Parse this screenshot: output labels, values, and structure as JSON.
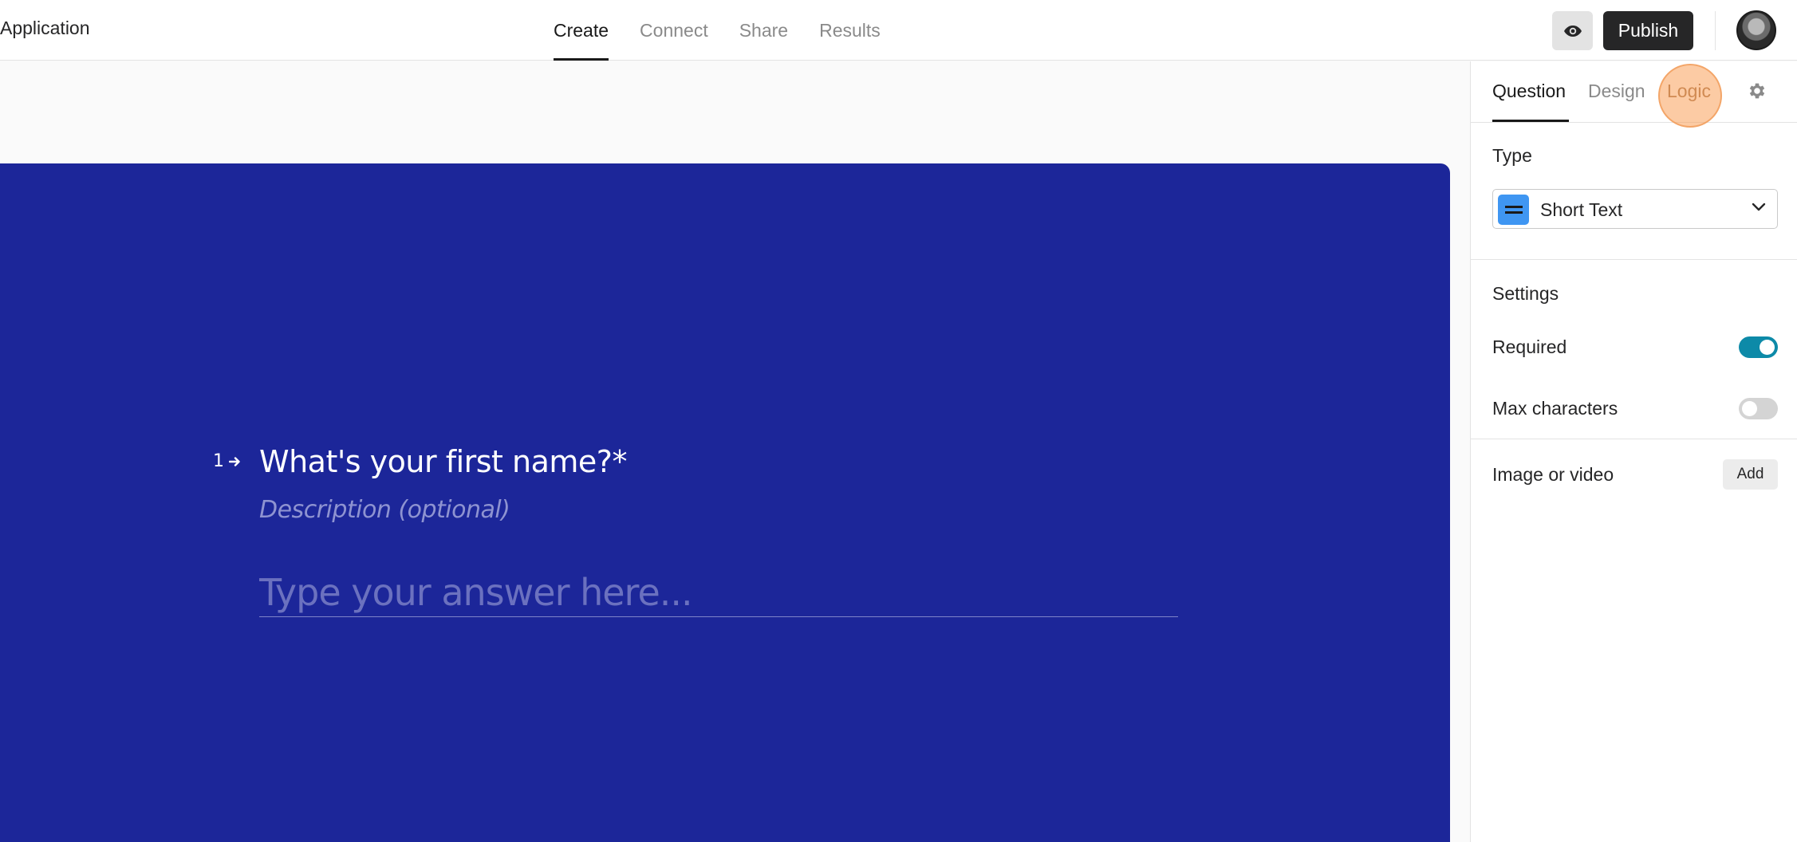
{
  "header": {
    "app_title": "Application",
    "tabs": [
      {
        "label": "Create",
        "active": true
      },
      {
        "label": "Connect",
        "active": false
      },
      {
        "label": "Share",
        "active": false
      },
      {
        "label": "Results",
        "active": false
      }
    ],
    "preview_icon": "eye-icon",
    "publish_label": "Publish"
  },
  "question": {
    "number": "1",
    "arrow_icon": "arrow-right-icon",
    "title": "What's your first name?*",
    "description_placeholder": "Description (optional)",
    "answer_placeholder": "Type your answer here..."
  },
  "panel": {
    "tabs": [
      {
        "label": "Question",
        "active": true
      },
      {
        "label": "Design",
        "active": false
      },
      {
        "label": "Logic",
        "active": false
      }
    ],
    "settings_icon": "gear-icon",
    "type_label": "Type",
    "type_value": "Short Text",
    "settings_heading": "Settings",
    "required_label": "Required",
    "required_on": true,
    "max_chars_label": "Max characters",
    "max_chars_on": false,
    "media_label": "Image or video",
    "add_label": "Add"
  },
  "colors": {
    "canvas_bg": "#1c2699",
    "toggle_on": "#0d8aa8",
    "type_icon_bg": "#3f96f2"
  }
}
